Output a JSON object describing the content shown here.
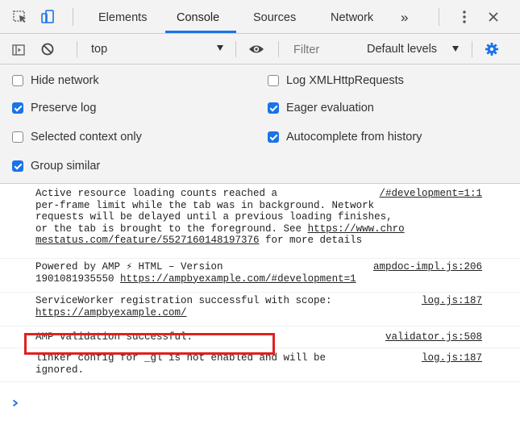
{
  "tabbar": {
    "tabs": [
      {
        "label": "Elements",
        "active": false
      },
      {
        "label": "Console",
        "active": true
      },
      {
        "label": "Sources",
        "active": false
      },
      {
        "label": "Network",
        "active": false
      }
    ],
    "more_label": "»",
    "icons": [
      "inspect-element-icon",
      "device-toolbar-icon",
      "kebab-menu-icon",
      "close-icon"
    ]
  },
  "toolbar": {
    "context": "top",
    "filter_placeholder": "Filter",
    "levels": "Default levels",
    "icons": [
      "sidebar-toggle-icon",
      "clear-console-icon",
      "live-expression-eye-icon",
      "settings-gear-icon"
    ]
  },
  "settings": {
    "options": [
      {
        "label": "Hide network",
        "checked": false
      },
      {
        "label": "Log XMLHttpRequests",
        "checked": false
      },
      {
        "label": "Preserve log",
        "checked": true
      },
      {
        "label": "Eager evaluation",
        "checked": true
      },
      {
        "label": "Selected context only",
        "checked": false
      },
      {
        "label": "Autocomplete from history",
        "checked": true
      },
      {
        "label": "Group similar",
        "checked": true
      }
    ]
  },
  "messages": [
    {
      "source": "/#development=1:1",
      "lines": [
        "Active resource loading counts reached a",
        "per-frame limit while the tab was in background. Network",
        "requests will be delayed until a previous loading finishes,",
        "or the tab is brought to the foreground. See "
      ],
      "link_part1": "https://www.chro",
      "link_part2": "mestatus.com/feature/5527160148197376",
      "tail": " for more details"
    },
    {
      "source": "ampdoc-impl.js:206",
      "line1": "Powered by AMP ⚡ HTML – Version",
      "line2_prefix": "1901081935550 ",
      "line2_link": "https://ampbyexample.com/#development=1"
    },
    {
      "source": "log.js:187",
      "line1": "ServiceWorker registration successful with scope:",
      "line2_link": "https://ampbyexample.com/"
    },
    {
      "source": "validator.js:508",
      "line1": "AMP validation successful."
    },
    {
      "source": "log.js:187",
      "line1": "linker config for _gl is not enabled and will be",
      "line2": "ignored."
    }
  ],
  "colors": {
    "accent": "#1a73e8",
    "highlight_box": "#e02020",
    "prompt": "#1a73e8"
  }
}
